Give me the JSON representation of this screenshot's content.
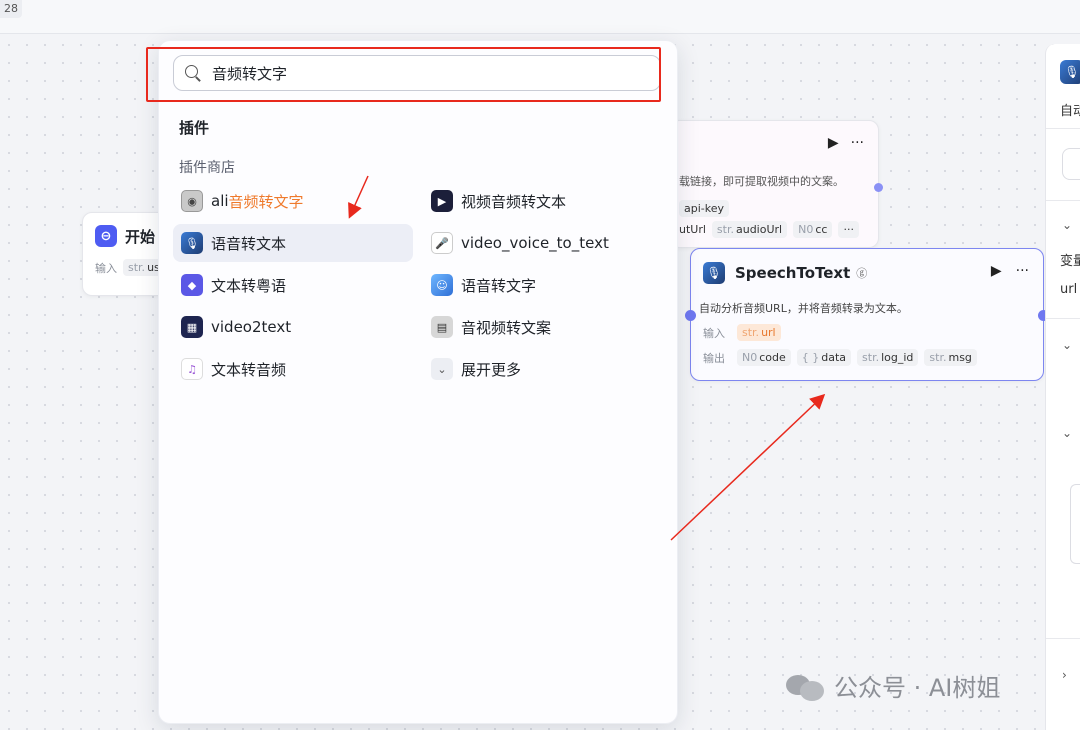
{
  "canvas": {
    "zoom_label": "28",
    "start_node": {
      "title": "开始",
      "input_label": "输入",
      "input_chip_type": "str.",
      "input_chip_name": "us"
    },
    "behind_node": {
      "description": "载链接，即可提取视频中的文案。",
      "chip1_name": "api-key",
      "row2_text": "utUrl",
      "chip2_type": "str.",
      "chip2_name": "audioUrl",
      "chip3_type": "N0",
      "chip3_name": "cc",
      "more": "···"
    },
    "stt_node": {
      "title": "SpeechToText",
      "badge": "ⓖ",
      "description": "自动分析音频URL，并将音频转录为文本。",
      "input_label": "输入",
      "input_type": "str.",
      "input_name": "url",
      "output_label": "输出",
      "outputs": [
        {
          "type": "N0",
          "name": "code"
        },
        {
          "type": "{ }",
          "name": "data"
        },
        {
          "type": "str.",
          "name": "log_id"
        },
        {
          "type": "str.",
          "name": "msg"
        }
      ]
    }
  },
  "right_panel": {
    "desc_fragment": "自动",
    "var_label": "变量",
    "url_label": "url"
  },
  "popup": {
    "search": {
      "value": "音频转文字",
      "placeholder": ""
    },
    "section_title": "插件",
    "subsection_title": "插件商店",
    "items": [
      {
        "prefix": "ali",
        "highlight": "音频转文字",
        "icon": "ali-plugin-icon"
      },
      {
        "prefix": "",
        "highlight": "视频音频转文本",
        "icon": "video-icon"
      },
      {
        "prefix": "",
        "highlight": "语音转文本",
        "icon": "microphone-icon"
      },
      {
        "prefix": "",
        "highlight": "video_voice_to_text",
        "icon": "mic-stand-icon"
      },
      {
        "prefix": "",
        "highlight": "文本转粤语",
        "icon": "cube-icon"
      },
      {
        "prefix": "",
        "highlight": "语音转文字",
        "icon": "voice-avatar-icon"
      },
      {
        "prefix": "",
        "highlight": "video2text",
        "icon": "video2text-icon"
      },
      {
        "prefix": "",
        "highlight": "音视频转文案",
        "icon": "video-text-icon"
      },
      {
        "prefix": "",
        "highlight": "文本转音频",
        "icon": "audio-wave-icon"
      },
      {
        "prefix": "",
        "highlight": "展开更多",
        "icon": "chevron-down-icon"
      }
    ]
  },
  "watermark": {
    "text": "公众号 · AI树姐"
  },
  "colors": {
    "accent": "#4e5cf2",
    "highlight": "#ef7a2c",
    "annotation_red": "#e8291d",
    "selected_border": "#7d86f0"
  }
}
